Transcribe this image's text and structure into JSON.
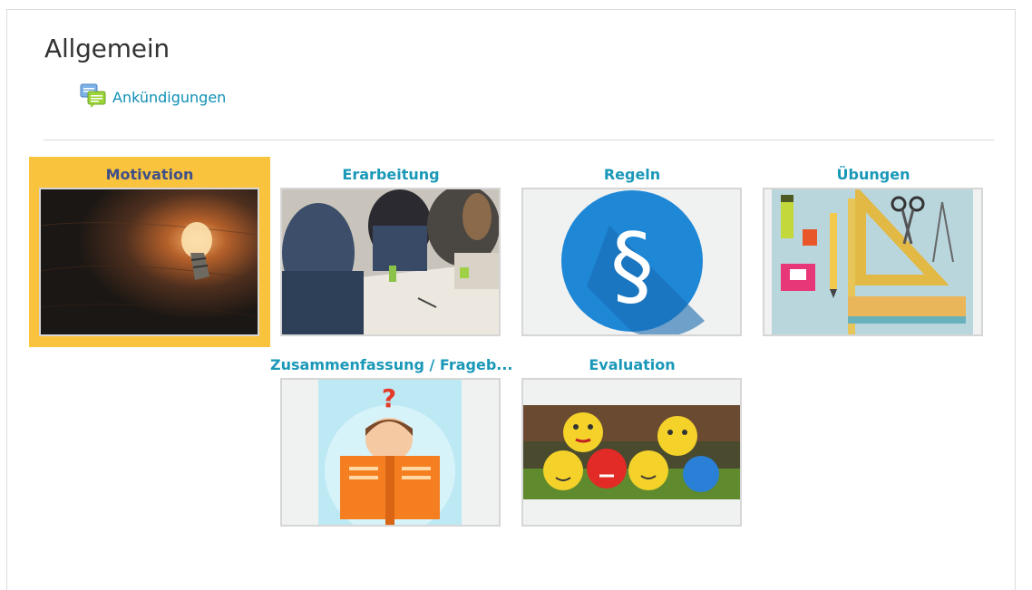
{
  "section": {
    "title": "Allgemein"
  },
  "announcements": {
    "label": "Ankündigungen",
    "icon": "forum-icon"
  },
  "tiles": [
    {
      "title": "Motivation",
      "image": "lightbulb-image",
      "active": true
    },
    {
      "title": "Erarbeitung",
      "image": "group-work-image",
      "active": false
    },
    {
      "title": "Regeln",
      "image": "paragraph-sign-image",
      "active": false
    },
    {
      "title": "Übungen",
      "image": "school-supplies-image",
      "active": false
    },
    {
      "title": "Zusammenfassung / Frageb...",
      "image": "reading-child-image",
      "active": false
    },
    {
      "title": "Evaluation",
      "image": "emoji-balls-image",
      "active": false
    }
  ],
  "colors": {
    "link": "#0f8fb5",
    "tile_title": "#1a98b8",
    "active_tile_bg": "#f9c33d",
    "active_tile_title": "#3e4f8a"
  }
}
